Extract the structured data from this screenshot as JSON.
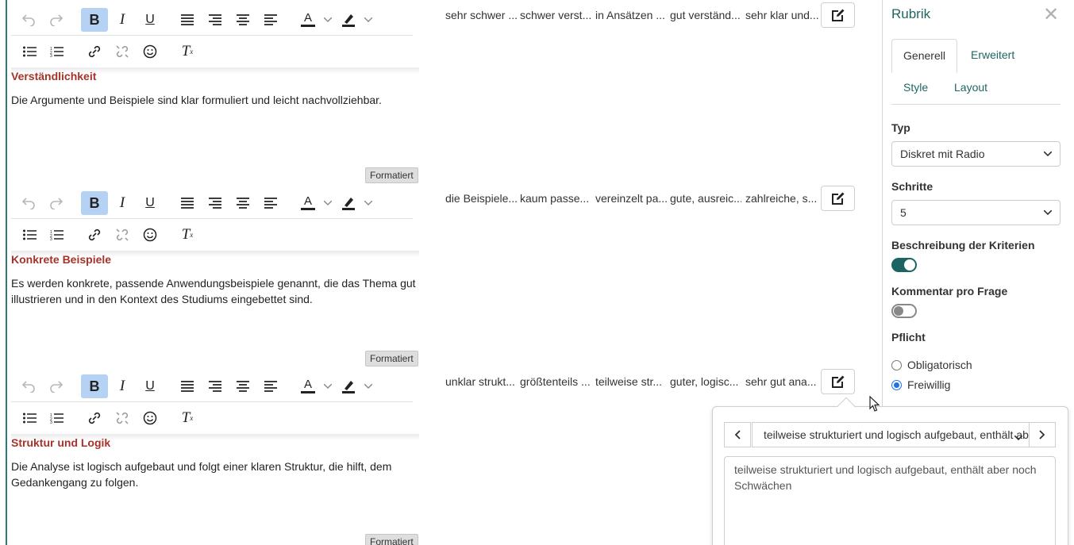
{
  "criteria": [
    {
      "title": "",
      "description": "",
      "levels": [
        "sehr schwer ...",
        "schwer verst...",
        "in Ansätzen ...",
        "gut verständ...",
        "sehr klar und..."
      ]
    },
    {
      "title": "Verständlichkeit",
      "description": "Die Argumente und Beispiele sind klar formuliert und leicht nachvollziehbar.",
      "badge": "Formatiert",
      "levels": [
        "die Beispiele...",
        "kaum passe...",
        "vereinzelt pa...",
        "gute, ausreic...",
        "zahlreiche, s..."
      ]
    },
    {
      "title": "Konkrete Beispiele",
      "description": "Es werden konkrete, passende Anwendungsbeispiele genannt, die das Thema gut illustrieren und in den Kontext des Studiums eingebettet sind.",
      "badge": "Formatiert",
      "levels": [
        "unklar strukt...",
        "größtenteils ...",
        "teilweise str...",
        "guter, logisc...",
        "sehr gut ana..."
      ]
    },
    {
      "title": "Struktur und Logik",
      "description": "Die Analyse ist logisch aufgebaut und folgt einer klaren Struktur, die hilft, dem Gedankengang zu folgen.",
      "badge": "Formatiert"
    }
  ],
  "toolbar": {
    "icons": [
      "undo-icon",
      "redo-icon",
      "bold-icon",
      "italic-icon",
      "underline-icon",
      "align-justify-icon",
      "align-right-icon",
      "align-center-icon",
      "align-left-icon",
      "text-color-icon",
      "highlight-color-icon",
      "bullet-list-icon",
      "numbered-list-icon",
      "link-icon",
      "unlink-icon",
      "emoji-icon",
      "clear-format-icon"
    ],
    "bold": "B",
    "italic": "I",
    "underline": "U",
    "text_color_glyph": "A",
    "clear_format_glyph": "T",
    "clear_format_sub": "x"
  },
  "panel": {
    "title": "Rubrik",
    "close": "✕",
    "tabs": [
      "Generell",
      "Erweitert",
      "Style",
      "Layout"
    ],
    "active_tab": "Generell",
    "typ_label": "Typ",
    "typ_value": "Diskret mit Radio",
    "schritte_label": "Schritte",
    "schritte_value": "5",
    "beschreibung_label": "Beschreibung der Kriterien",
    "beschreibung_on": true,
    "kommentar_label": "Kommentar pro Frage",
    "kommentar_on": false,
    "pflicht_label": "Pflicht",
    "pflicht_options": [
      "Obligatorisch",
      "Freiwillig"
    ],
    "pflicht_selected": "Freiwillig"
  },
  "popover": {
    "select_value": "teilweise strukturiert und logisch aufgebaut, enthält aber noch Schwächen",
    "textarea_value": "teilweise strukturiert und logisch aufgebaut, enthält aber noch Schwächen"
  },
  "colors": {
    "accent": "#1f6662",
    "criterion_title": "#a6332a",
    "active_button": "#b5d1f3",
    "toggle_on": "#1a6561"
  }
}
